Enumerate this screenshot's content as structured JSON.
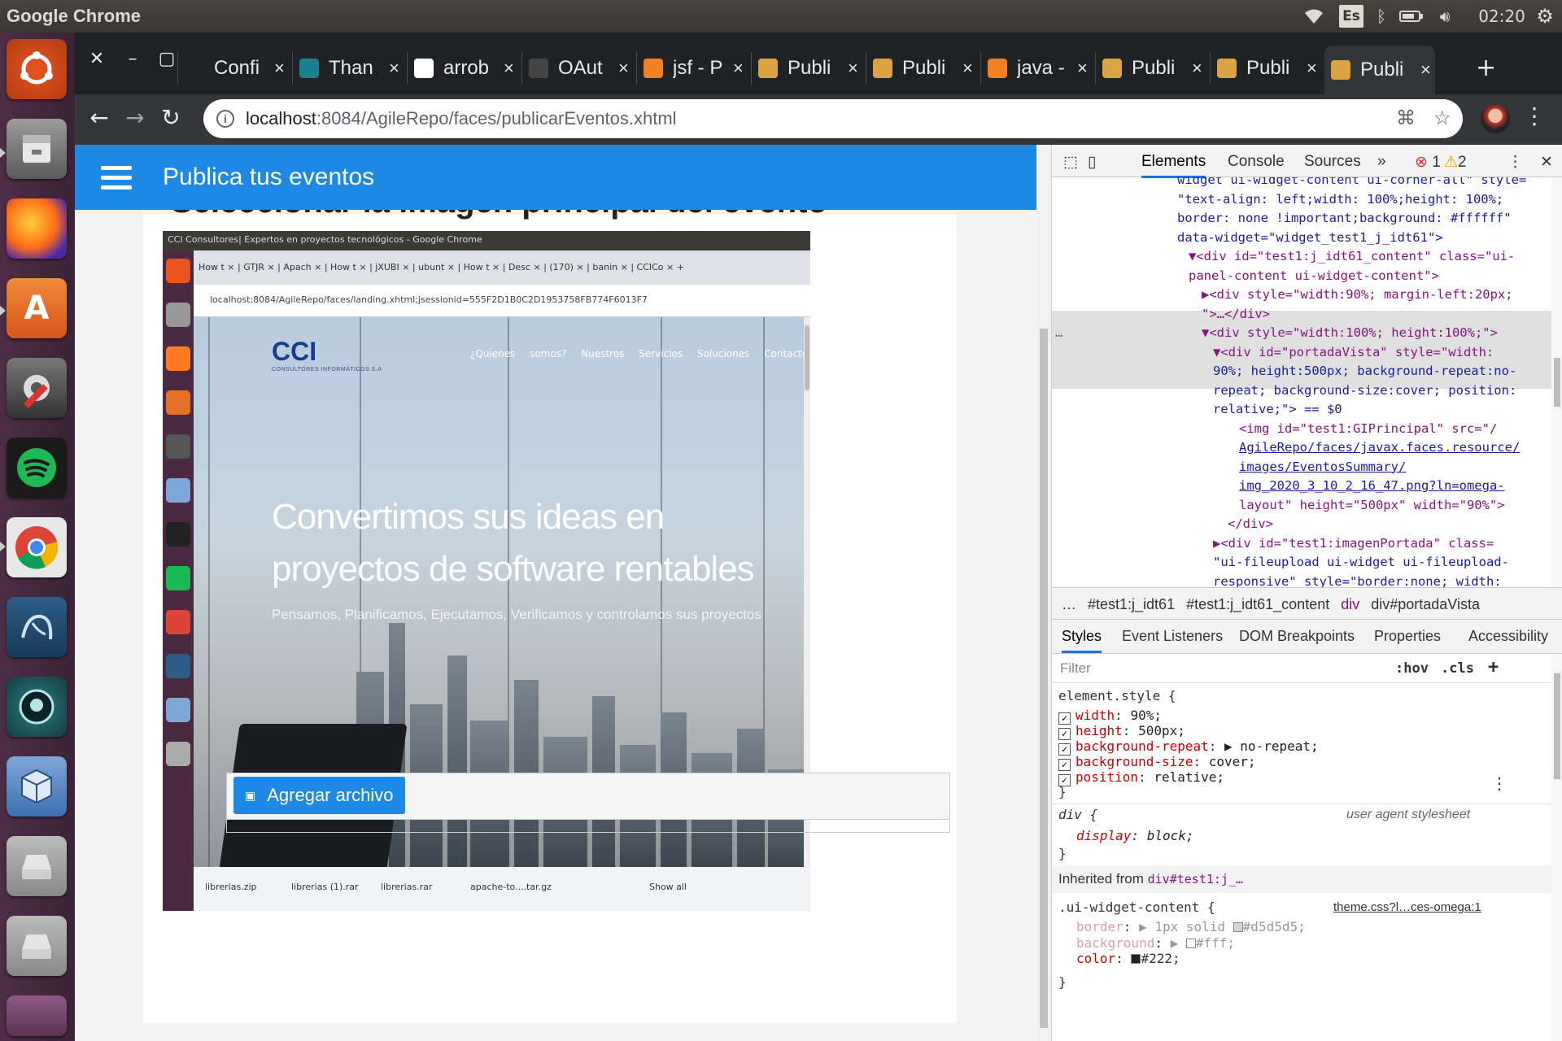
{
  "system": {
    "app_title": "Google Chrome",
    "lang": "Es",
    "time": "02:20"
  },
  "tabs": [
    {
      "label": "Confi",
      "icon": "github-icon",
      "color": "#202124"
    },
    {
      "label": "Than",
      "icon": "openshift-icon",
      "color": "#1a7f8f"
    },
    {
      "label": "arrob",
      "icon": "google-icon",
      "color": "#ffffff"
    },
    {
      "label": "OAut",
      "icon": "oauth-icon",
      "color": "#444444"
    },
    {
      "label": "jsf - P",
      "icon": "stackoverflow-icon",
      "color": "#f48024"
    },
    {
      "label": "Publi",
      "icon": "app-icon",
      "color": "#d9a441"
    },
    {
      "label": "Publi",
      "icon": "app-icon",
      "color": "#d9a441"
    },
    {
      "label": "java -",
      "icon": "stackoverflow-icon",
      "color": "#f48024"
    },
    {
      "label": "Publi",
      "icon": "app-icon",
      "color": "#d9a441"
    },
    {
      "label": "Publi",
      "icon": "app-icon",
      "color": "#d9a441"
    },
    {
      "label": "Publi",
      "icon": "app-icon",
      "color": "#d9a441",
      "active": true
    }
  ],
  "omnibox": {
    "host": "localhost",
    "path": ":8084/AgileRepo/faces/publicarEventos.xhtml"
  },
  "page": {
    "app_title": "Publica tus eventos",
    "heading": "Seleccionar la imagen principal del evento",
    "add_button": "Agregar archivo",
    "accent": "#1e88e5"
  },
  "preview": {
    "window_title": "CCI Consultores| Expertos en proyectos tecnológicos - Google Chrome",
    "tabs_text": "How t ×  | GTJR ×  | Apach ×  | How t ×  | jXUBI ×  | ubunt ×  | How t ×  | Desc ×  | (170) ×  | banin ×  | CCICo ×  +",
    "address": "localhost:8084/AgileRepo/faces/landing.xhtml;jsessionid=555F2D1B0C2D1953758FB774F6013F7",
    "logo": "CCI",
    "logo_sub": "CONSULTORES INFORMÁTICOS S.A",
    "nav": "¿Quienes somos?  Nuestros Servicios  Soluciones  Contacto  Eventos",
    "headline": "Convertimos sus ideas en proyectos de software rentables",
    "subline": "Pensamos, Planificamos, Ejecutamos, Verificamos y controlamos sus proyectos",
    "downloads": [
      "librerias.zip",
      "librerias (1).rar",
      "librerias.rar",
      "apache-to....tar.gz"
    ],
    "show_all": "Show all"
  },
  "devtools": {
    "tabs": [
      "Elements",
      "Console",
      "Sources"
    ],
    "errors": "1",
    "warnings": "2",
    "dom": [
      {
        "text": "widget ui-widget-content ui-corner-all\" style=",
        "cls": "av"
      },
      {
        "text": "\"text-align: left;width: 100%;height: 100%;",
        "cls": "av"
      },
      {
        "text": "border: none !important;background: #ffffff\"",
        "cls": "av"
      },
      {
        "text": "data-widget=\"widget_test1_j_idt61\">",
        "cls": "mix"
      },
      {
        "text": "▼<div id=\"test1:j_idt61_content\" class=\"ui-",
        "cls": "tg"
      },
      {
        "text": "panel-content ui-widget-content\">",
        "cls": "tg"
      },
      {
        "text": "▶<div style=\"width:90%; margin-left:20px;",
        "cls": "tg"
      },
      {
        "text": "\">…</div>",
        "cls": "tg"
      },
      {
        "text": "▼<div style=\"width:100%; height:100%;\">",
        "cls": "tg"
      },
      {
        "text": "▼<div id=\"portadaVista\" style=\"width:",
        "cls": "tg"
      },
      {
        "text": "90%; height:500px; background-repeat:no-",
        "cls": "av"
      },
      {
        "text": "repeat; background-size:cover; position:",
        "cls": "av"
      },
      {
        "text": "relative;\"> == $0",
        "cls": "av"
      },
      {
        "text": "<img id=\"test1:GIPrincipal\" src=\"/",
        "cls": "tg"
      },
      {
        "text": "AgileRepo/faces/javax.faces.resource/",
        "cls": "lk"
      },
      {
        "text": "images/EventosSummary/",
        "cls": "lk"
      },
      {
        "text": "img_2020_3_10_2_16_47.png?ln=omega-",
        "cls": "lk"
      },
      {
        "text": "layout\" height=\"500px\" width=\"90%\">",
        "cls": "tg"
      },
      {
        "text": "</div>",
        "cls": "tg"
      },
      {
        "text": "▶<div id=\"test1:imagenPortada\" class=",
        "cls": "tg"
      },
      {
        "text": "\"ui-fileupload ui-widget ui-fileupload-",
        "cls": "av"
      },
      {
        "text": "responsive\" style=\"border:none; width:",
        "cls": "av"
      }
    ],
    "breadcrumbs": [
      "…",
      "#test1:j_idt61",
      "#test1:j_idt61_content",
      "div",
      "div#portadaVista"
    ],
    "style_tabs": [
      "Styles",
      "Event Listeners",
      "DOM Breakpoints",
      "Properties",
      "Accessibility"
    ],
    "filter_placeholder": "Filter",
    "hov": ":hov",
    "cls": ".cls",
    "element_style": {
      "selector": "element.style {",
      "props": [
        {
          "name": "width",
          "value": "90%;"
        },
        {
          "name": "height",
          "value": "500px;"
        },
        {
          "name": "background-repeat",
          "value": "▶ no-repeat;"
        },
        {
          "name": "background-size",
          "value": "cover;"
        },
        {
          "name": "position",
          "value": "relative;"
        }
      ]
    },
    "div_rule": {
      "selector": "div {",
      "source": "user agent stylesheet",
      "prop": "display",
      "value": "block;"
    },
    "inherited": "Inherited from",
    "inherited_from": "div#test1:j_…",
    "widget_rule": {
      "selector": ".ui-widget-content {",
      "source": "theme.css?l…ces-omega:1",
      "props": [
        {
          "name": "border",
          "value": "▶ 1px solid",
          "swatch": "#d5d5d5",
          "swatch_label": "#d5d5d5;"
        },
        {
          "name": "background",
          "value": "▶",
          "swatch": "#ffffff",
          "swatch_label": "#fff;"
        },
        {
          "name": "color",
          "value": "",
          "swatch": "#222222",
          "swatch_label": "#222;"
        }
      ]
    }
  }
}
